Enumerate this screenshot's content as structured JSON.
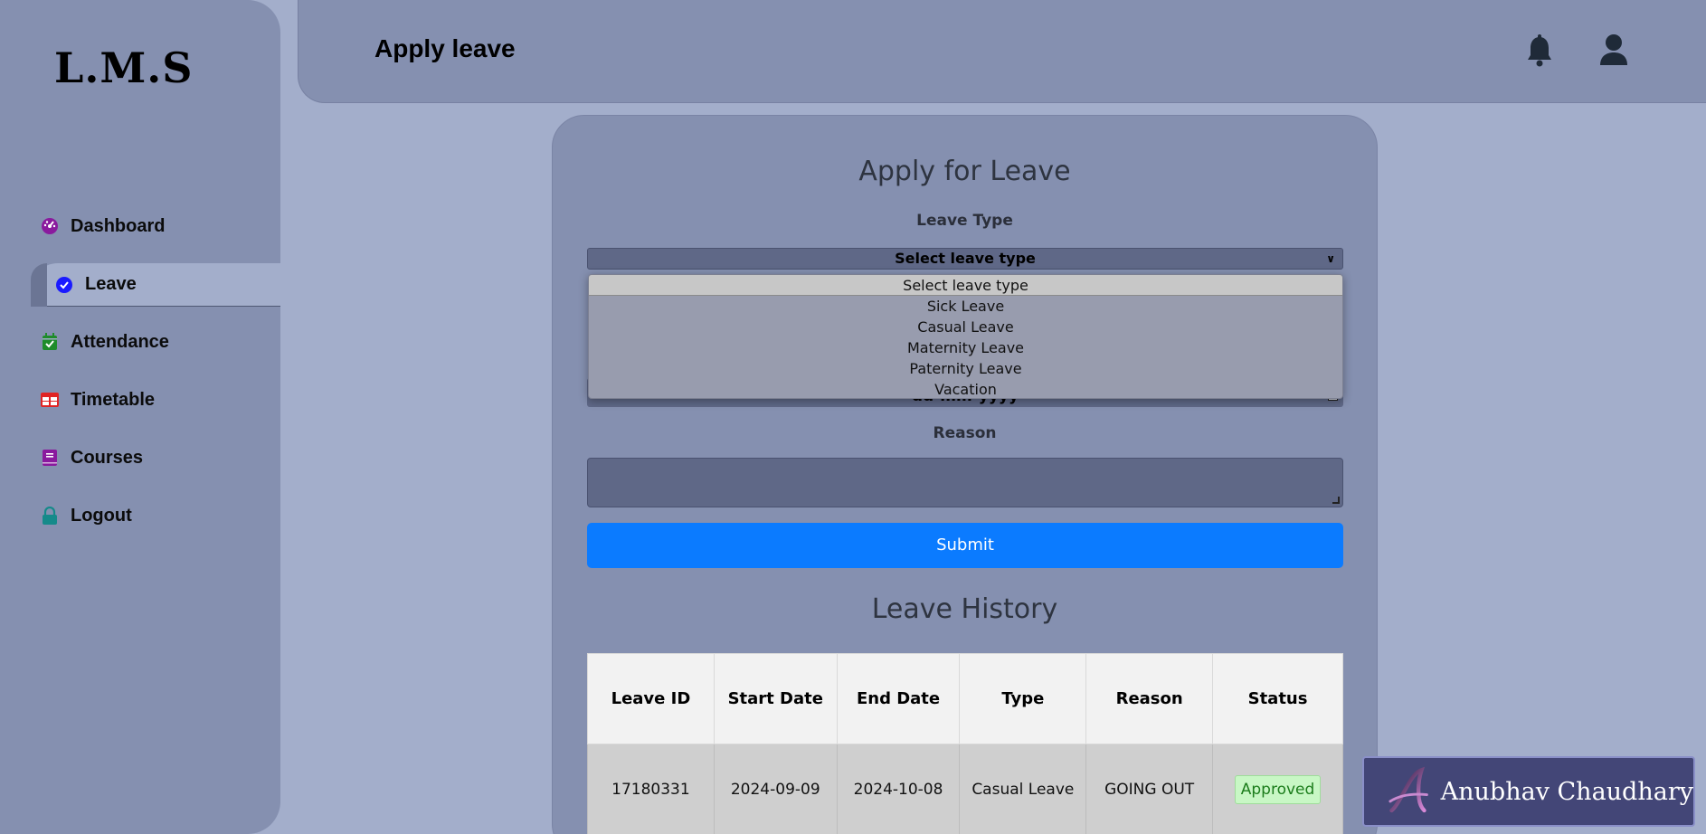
{
  "sidebar": {
    "logo": "L.M.S",
    "items": [
      {
        "label": "Dashboard",
        "icon": "dashboard-icon",
        "color": "#8a1a9e"
      },
      {
        "label": "Leave",
        "icon": "check-circle-icon",
        "color": "#1a1aff",
        "active": true
      },
      {
        "label": "Attendance",
        "icon": "calendar-check-icon",
        "color": "#1e8c2a"
      },
      {
        "label": "Timetable",
        "icon": "table-icon",
        "color": "#e02424"
      },
      {
        "label": "Courses",
        "icon": "book-icon",
        "color": "#8a1a9e"
      },
      {
        "label": "Logout",
        "icon": "lock-icon",
        "color": "#158a8a"
      }
    ]
  },
  "header": {
    "title": "Apply leave",
    "icons": [
      "bell-icon",
      "user-icon"
    ]
  },
  "form": {
    "title": "Apply for Leave",
    "leave_type_label": "Leave Type",
    "leave_type_selected": "Select leave type",
    "leave_type_options": [
      "Select leave type",
      "Sick Leave",
      "Casual Leave",
      "Maternity Leave",
      "Paternity Leave",
      "Vacation"
    ],
    "date_placeholder": "dd-mm-yyyy",
    "reason_label": "Reason",
    "reason_value": "",
    "submit_label": "Submit"
  },
  "history": {
    "title": "Leave History",
    "columns": [
      "Leave ID",
      "Start Date",
      "End Date",
      "Type",
      "Reason",
      "Status"
    ],
    "rows": [
      [
        "17180331",
        "2024-09-09",
        "2024-10-08",
        "Casual Leave",
        "GOING OUT",
        "Approved"
      ]
    ]
  },
  "watermark": {
    "initial": "A",
    "name": "Anubhav Chaudhary"
  },
  "colors": {
    "accent": "#0b7bff",
    "background": "#a3aecb",
    "panel": "#8590b0",
    "status_approved": "#c8f7c5"
  }
}
